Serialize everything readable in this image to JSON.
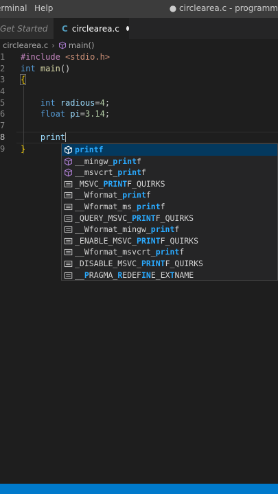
{
  "titlebar": {
    "menus": [
      "erminal",
      "Help"
    ],
    "window_title": "● circlearea.c - programm"
  },
  "tabs": [
    {
      "label": "Get Started"
    },
    {
      "label": "circlearea.c",
      "icon_glyph": "C",
      "icon": "c-file-icon",
      "dirty": true
    }
  ],
  "breadcrumb": {
    "file": "circlearea.c",
    "separator": "›",
    "symbol": "main()",
    "symbol_icon": "method-cube-icon"
  },
  "editor": {
    "line_numbers": [
      "1",
      "2",
      "3",
      "4",
      "5",
      "6",
      "7",
      "8",
      "9"
    ],
    "active_line": "8",
    "lines": [
      {
        "parts": [
          {
            "t": "#include ",
            "c": "pp"
          },
          {
            "t": "<stdio.h>",
            "c": "str"
          }
        ]
      },
      {
        "parts": [
          {
            "t": "int",
            "c": "kw"
          },
          {
            "t": " ",
            "c": ""
          },
          {
            "t": "main",
            "c": "fn"
          },
          {
            "t": "()",
            "c": ""
          }
        ]
      },
      {
        "parts": [
          {
            "t": "{",
            "c": "brace brace-match"
          }
        ]
      },
      {
        "parts": []
      },
      {
        "parts": [
          {
            "t": "    ",
            "c": ""
          },
          {
            "t": "int",
            "c": "kw"
          },
          {
            "t": " ",
            "c": ""
          },
          {
            "t": "radious",
            "c": "id"
          },
          {
            "t": "=",
            "c": ""
          },
          {
            "t": "4",
            "c": "num"
          },
          {
            "t": ";",
            "c": ""
          }
        ]
      },
      {
        "parts": [
          {
            "t": "    ",
            "c": ""
          },
          {
            "t": "float",
            "c": "kw"
          },
          {
            "t": " ",
            "c": ""
          },
          {
            "t": "pi",
            "c": "id"
          },
          {
            "t": "=",
            "c": ""
          },
          {
            "t": "3.14",
            "c": "num"
          },
          {
            "t": ";",
            "c": ""
          }
        ]
      },
      {
        "parts": []
      },
      {
        "parts": [
          {
            "t": "    ",
            "c": ""
          },
          {
            "t": "print",
            "c": "id"
          }
        ],
        "caret": true
      },
      {
        "parts": [
          {
            "t": "}",
            "c": "brace"
          }
        ]
      }
    ]
  },
  "suggestions": [
    {
      "icon": "method-cube-icon",
      "parts": [
        {
          "t": "printf",
          "h": true
        }
      ],
      "selected": true
    },
    {
      "icon": "method-cube-icon",
      "parts": [
        {
          "t": "__mingw_"
        },
        {
          "t": "print",
          "h": true
        },
        {
          "t": "f"
        }
      ]
    },
    {
      "icon": "method-cube-icon",
      "parts": [
        {
          "t": "__msvcrt_"
        },
        {
          "t": "print",
          "h": true
        },
        {
          "t": "f"
        }
      ]
    },
    {
      "icon": "text-icon",
      "parts": [
        {
          "t": "_MSVC_"
        },
        {
          "t": "PRINT",
          "h": true
        },
        {
          "t": "F_QUIRKS"
        }
      ]
    },
    {
      "icon": "text-icon",
      "parts": [
        {
          "t": "__Wformat_"
        },
        {
          "t": "print",
          "h": true
        },
        {
          "t": "f"
        }
      ]
    },
    {
      "icon": "text-icon",
      "parts": [
        {
          "t": "__Wformat_ms_"
        },
        {
          "t": "print",
          "h": true
        },
        {
          "t": "f"
        }
      ]
    },
    {
      "icon": "text-icon",
      "parts": [
        {
          "t": "_QUERY_MSVC_"
        },
        {
          "t": "PRINT",
          "h": true
        },
        {
          "t": "F_QUIRKS"
        }
      ]
    },
    {
      "icon": "text-icon",
      "parts": [
        {
          "t": "__Wformat_mingw_"
        },
        {
          "t": "print",
          "h": true
        },
        {
          "t": "f"
        }
      ]
    },
    {
      "icon": "text-icon",
      "parts": [
        {
          "t": "_ENABLE_MSVC_"
        },
        {
          "t": "PRINT",
          "h": true
        },
        {
          "t": "F_QUIRKS"
        }
      ]
    },
    {
      "icon": "text-icon",
      "parts": [
        {
          "t": "__Wformat_msvcrt_"
        },
        {
          "t": "print",
          "h": true
        },
        {
          "t": "f"
        }
      ]
    },
    {
      "icon": "text-icon",
      "parts": [
        {
          "t": "_DISABLE_MSVC_"
        },
        {
          "t": "PRINT",
          "h": true
        },
        {
          "t": "F_QUIRKS"
        }
      ]
    },
    {
      "icon": "text-icon",
      "parts": [
        {
          "t": "__"
        },
        {
          "t": "P",
          "h": true
        },
        {
          "t": "RAGMA_"
        },
        {
          "t": "R",
          "h": true
        },
        {
          "t": "EDEF"
        },
        {
          "t": "IN",
          "h": true
        },
        {
          "t": "E_EX"
        },
        {
          "t": "T",
          "h": true
        },
        {
          "t": "NAME"
        }
      ]
    }
  ],
  "colors": {
    "status_bar": "#007acc",
    "suggest_selected": "#04395e",
    "match_highlight": "#2aaaff",
    "method_icon": "#b180d7"
  }
}
